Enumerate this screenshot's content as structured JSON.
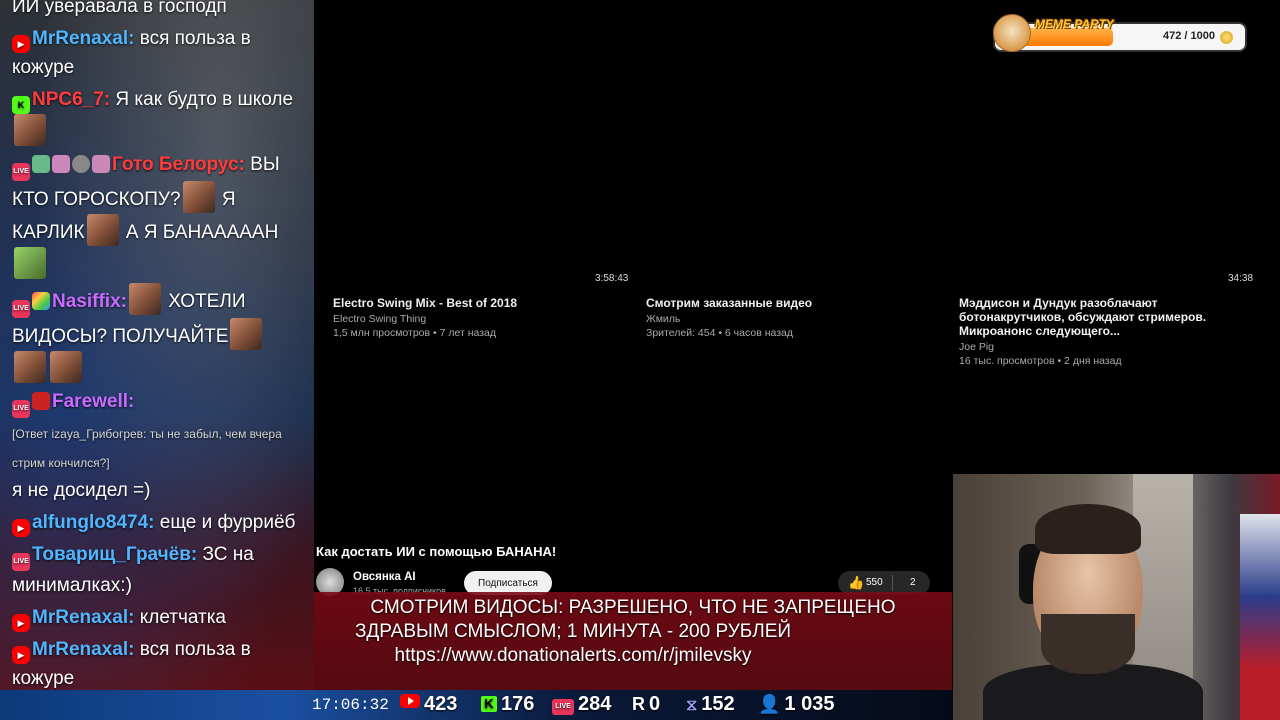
{
  "chat": {
    "messages": [
      {
        "user": "",
        "user_color": "#ffffff",
        "text": "ИИ уверавала в господп"
      },
      {
        "user": "MrRenaxal:",
        "user_color": "#4fb6ff",
        "text": " вся польза в кожуре"
      },
      {
        "user": "NPC6_7:",
        "user_color": "#ff3b3b",
        "text": " Я как будто в школе"
      },
      {
        "user": "Гото Белорус:",
        "user_color": "#ff3b3b",
        "text": " ВЫ КТО ГОРОСКОПУ?",
        "text2": " Я КАРЛИК",
        "text3": " А Я БАНАААААН"
      },
      {
        "user": "Nasiffix:",
        "user_color": "#c96bff",
        "text": " ХОТЕЛИ ВИДОСЫ? ПОЛУЧАЙТЕ"
      },
      {
        "user": "Farewell:",
        "user_color": "#c96bff",
        "reply": "[Ответ izaya_Грибогрев: ты не забыл, чем вчера стрим кончился?]",
        "text": "я не досидел =)"
      },
      {
        "user": "alfunglo8474:",
        "user_color": "#4fb6ff",
        "text": " еще и фурриёб"
      },
      {
        "user": "Товарищ_Грачёв:",
        "user_color": "#4fb6ff",
        "text": " ЗС на минималках:)"
      },
      {
        "user": "MrRenaxal:",
        "user_color": "#4fb6ff",
        "text": " клетчатка"
      },
      {
        "user": "MrRenaxal:",
        "user_color": "#4fb6ff",
        "text": " вся польза в кожуре"
      }
    ],
    "badges": {
      "live": "LIVE"
    }
  },
  "videos": [
    {
      "duration": "",
      "title": "Electro Swing Mix - Best of 2018",
      "channel": "Electro Swing Thing",
      "meta": "1,5 млн просмотров • 7 лет назад"
    },
    {
      "duration": "3:58:43",
      "title": "Смотрим заказанные видео",
      "channel": "Жмиль",
      "meta": "Зрителей: 454 • 6 часов назад"
    },
    {
      "duration": "34:38",
      "title": "Мэддисон и Дундук разоблачают ботонакрутчиков, обсуждают стримеров. Микроанонс следующего...",
      "channel": "Joe Pig",
      "meta": "16 тыс. просмотров • 2 дня назад"
    }
  ],
  "current_video": {
    "title": "Как достать ИИ с помощью БАНАНА!",
    "channel": "Овсянка AI",
    "subscribers": "16,5 тыс. подписчиков",
    "subscribe_label": "Подписаться",
    "likes": "550",
    "dislikes_or_comments": "2"
  },
  "banner": {
    "line1": "СМОТРИМ ВИДОСЫ: РАЗРЕШЕНО, ЧТО НЕ ЗАПРЕЩЕНО",
    "line2": "ЗДРАВЫМ СМЫСЛОМ; 1 МИНУТА - 200 РУБЛЕЙ",
    "line3": "https://www.donationalerts.com/r/jmilevsky"
  },
  "meme_party": {
    "label": "MEME PARTY",
    "count": "472 / 1000",
    "progress": 0.472
  },
  "stats": {
    "clock": "17:06:32",
    "youtube": "423",
    "kick": "176",
    "vk": "284",
    "r": "0",
    "twitch": "152",
    "total": "1 035"
  },
  "icons": {
    "youtube": "youtube-icon",
    "kick": "kick-icon",
    "vk": "vk-live-icon",
    "r": "rutube-icon",
    "twitch": "twitch-icon",
    "user": "user-icon",
    "coin": "coin-icon",
    "like": "thumbs-up-icon"
  }
}
